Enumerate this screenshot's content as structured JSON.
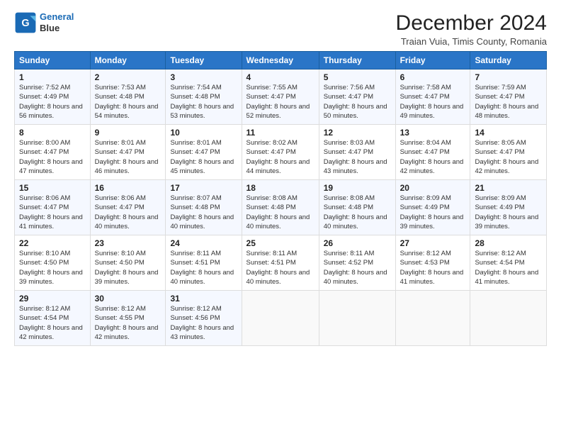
{
  "logo": {
    "line1": "General",
    "line2": "Blue"
  },
  "header": {
    "month": "December 2024",
    "location": "Traian Vuia, Timis County, Romania"
  },
  "weekdays": [
    "Sunday",
    "Monday",
    "Tuesday",
    "Wednesday",
    "Thursday",
    "Friday",
    "Saturday"
  ],
  "weeks": [
    [
      {
        "day": "1",
        "sunrise": "Sunrise: 7:52 AM",
        "sunset": "Sunset: 4:49 PM",
        "daylight": "Daylight: 8 hours and 56 minutes."
      },
      {
        "day": "2",
        "sunrise": "Sunrise: 7:53 AM",
        "sunset": "Sunset: 4:48 PM",
        "daylight": "Daylight: 8 hours and 54 minutes."
      },
      {
        "day": "3",
        "sunrise": "Sunrise: 7:54 AM",
        "sunset": "Sunset: 4:48 PM",
        "daylight": "Daylight: 8 hours and 53 minutes."
      },
      {
        "day": "4",
        "sunrise": "Sunrise: 7:55 AM",
        "sunset": "Sunset: 4:47 PM",
        "daylight": "Daylight: 8 hours and 52 minutes."
      },
      {
        "day": "5",
        "sunrise": "Sunrise: 7:56 AM",
        "sunset": "Sunset: 4:47 PM",
        "daylight": "Daylight: 8 hours and 50 minutes."
      },
      {
        "day": "6",
        "sunrise": "Sunrise: 7:58 AM",
        "sunset": "Sunset: 4:47 PM",
        "daylight": "Daylight: 8 hours and 49 minutes."
      },
      {
        "day": "7",
        "sunrise": "Sunrise: 7:59 AM",
        "sunset": "Sunset: 4:47 PM",
        "daylight": "Daylight: 8 hours and 48 minutes."
      }
    ],
    [
      {
        "day": "8",
        "sunrise": "Sunrise: 8:00 AM",
        "sunset": "Sunset: 4:47 PM",
        "daylight": "Daylight: 8 hours and 47 minutes."
      },
      {
        "day": "9",
        "sunrise": "Sunrise: 8:01 AM",
        "sunset": "Sunset: 4:47 PM",
        "daylight": "Daylight: 8 hours and 46 minutes."
      },
      {
        "day": "10",
        "sunrise": "Sunrise: 8:01 AM",
        "sunset": "Sunset: 4:47 PM",
        "daylight": "Daylight: 8 hours and 45 minutes."
      },
      {
        "day": "11",
        "sunrise": "Sunrise: 8:02 AM",
        "sunset": "Sunset: 4:47 PM",
        "daylight": "Daylight: 8 hours and 44 minutes."
      },
      {
        "day": "12",
        "sunrise": "Sunrise: 8:03 AM",
        "sunset": "Sunset: 4:47 PM",
        "daylight": "Daylight: 8 hours and 43 minutes."
      },
      {
        "day": "13",
        "sunrise": "Sunrise: 8:04 AM",
        "sunset": "Sunset: 4:47 PM",
        "daylight": "Daylight: 8 hours and 42 minutes."
      },
      {
        "day": "14",
        "sunrise": "Sunrise: 8:05 AM",
        "sunset": "Sunset: 4:47 PM",
        "daylight": "Daylight: 8 hours and 42 minutes."
      }
    ],
    [
      {
        "day": "15",
        "sunrise": "Sunrise: 8:06 AM",
        "sunset": "Sunset: 4:47 PM",
        "daylight": "Daylight: 8 hours and 41 minutes."
      },
      {
        "day": "16",
        "sunrise": "Sunrise: 8:06 AM",
        "sunset": "Sunset: 4:47 PM",
        "daylight": "Daylight: 8 hours and 40 minutes."
      },
      {
        "day": "17",
        "sunrise": "Sunrise: 8:07 AM",
        "sunset": "Sunset: 4:48 PM",
        "daylight": "Daylight: 8 hours and 40 minutes."
      },
      {
        "day": "18",
        "sunrise": "Sunrise: 8:08 AM",
        "sunset": "Sunset: 4:48 PM",
        "daylight": "Daylight: 8 hours and 40 minutes."
      },
      {
        "day": "19",
        "sunrise": "Sunrise: 8:08 AM",
        "sunset": "Sunset: 4:48 PM",
        "daylight": "Daylight: 8 hours and 40 minutes."
      },
      {
        "day": "20",
        "sunrise": "Sunrise: 8:09 AM",
        "sunset": "Sunset: 4:49 PM",
        "daylight": "Daylight: 8 hours and 39 minutes."
      },
      {
        "day": "21",
        "sunrise": "Sunrise: 8:09 AM",
        "sunset": "Sunset: 4:49 PM",
        "daylight": "Daylight: 8 hours and 39 minutes."
      }
    ],
    [
      {
        "day": "22",
        "sunrise": "Sunrise: 8:10 AM",
        "sunset": "Sunset: 4:50 PM",
        "daylight": "Daylight: 8 hours and 39 minutes."
      },
      {
        "day": "23",
        "sunrise": "Sunrise: 8:10 AM",
        "sunset": "Sunset: 4:50 PM",
        "daylight": "Daylight: 8 hours and 39 minutes."
      },
      {
        "day": "24",
        "sunrise": "Sunrise: 8:11 AM",
        "sunset": "Sunset: 4:51 PM",
        "daylight": "Daylight: 8 hours and 40 minutes."
      },
      {
        "day": "25",
        "sunrise": "Sunrise: 8:11 AM",
        "sunset": "Sunset: 4:51 PM",
        "daylight": "Daylight: 8 hours and 40 minutes."
      },
      {
        "day": "26",
        "sunrise": "Sunrise: 8:11 AM",
        "sunset": "Sunset: 4:52 PM",
        "daylight": "Daylight: 8 hours and 40 minutes."
      },
      {
        "day": "27",
        "sunrise": "Sunrise: 8:12 AM",
        "sunset": "Sunset: 4:53 PM",
        "daylight": "Daylight: 8 hours and 41 minutes."
      },
      {
        "day": "28",
        "sunrise": "Sunrise: 8:12 AM",
        "sunset": "Sunset: 4:54 PM",
        "daylight": "Daylight: 8 hours and 41 minutes."
      }
    ],
    [
      {
        "day": "29",
        "sunrise": "Sunrise: 8:12 AM",
        "sunset": "Sunset: 4:54 PM",
        "daylight": "Daylight: 8 hours and 42 minutes."
      },
      {
        "day": "30",
        "sunrise": "Sunrise: 8:12 AM",
        "sunset": "Sunset: 4:55 PM",
        "daylight": "Daylight: 8 hours and 42 minutes."
      },
      {
        "day": "31",
        "sunrise": "Sunrise: 8:12 AM",
        "sunset": "Sunset: 4:56 PM",
        "daylight": "Daylight: 8 hours and 43 minutes."
      },
      null,
      null,
      null,
      null
    ]
  ]
}
